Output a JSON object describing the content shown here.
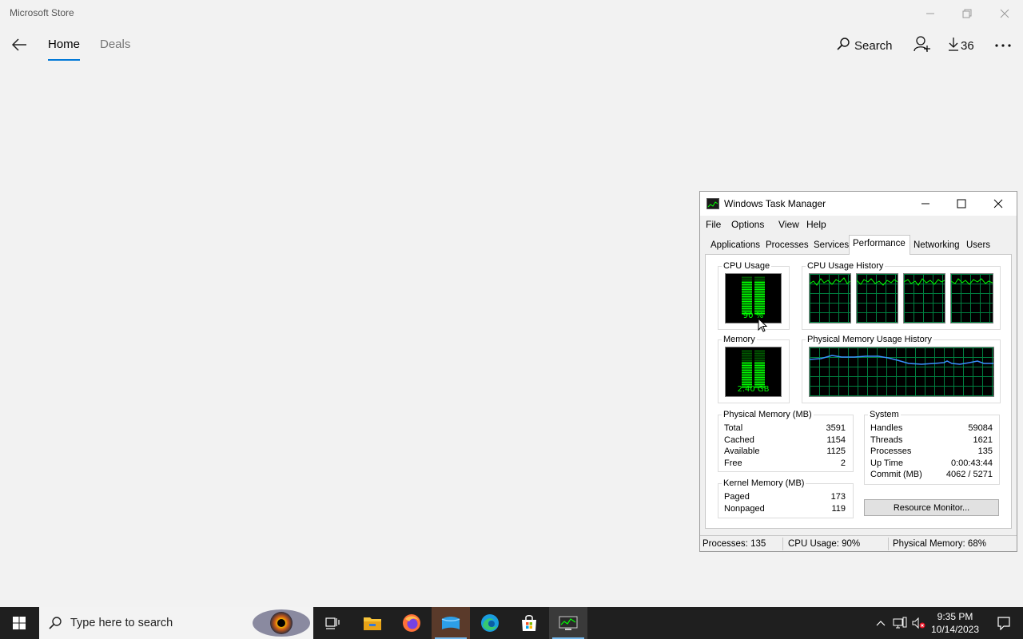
{
  "store": {
    "title": "Microsoft Store",
    "nav": {
      "home": "Home",
      "deals": "Deals"
    },
    "actions": {
      "search": "Search",
      "downloads": "36"
    }
  },
  "task_manager": {
    "title": "Windows Task Manager",
    "menu": [
      "File",
      "Options",
      "View",
      "Help"
    ],
    "tabs": [
      "Applications",
      "Processes",
      "Services",
      "Performance",
      "Networking",
      "Users"
    ],
    "active_tab": "Performance",
    "cpu_usage": {
      "label": "CPU Usage",
      "value": "90 %",
      "percent": 90
    },
    "cpu_history": {
      "label": "CPU Usage History",
      "cores": 4
    },
    "memory": {
      "label": "Memory",
      "value": "2.40 GB",
      "percent": 68
    },
    "memory_history": {
      "label": "Physical Memory Usage History"
    },
    "physical_memory": {
      "label": "Physical Memory (MB)",
      "rows": [
        {
          "k": "Total",
          "v": "3591"
        },
        {
          "k": "Cached",
          "v": "1154"
        },
        {
          "k": "Available",
          "v": "1125"
        },
        {
          "k": "Free",
          "v": "2"
        }
      ]
    },
    "kernel_memory": {
      "label": "Kernel Memory (MB)",
      "rows": [
        {
          "k": "Paged",
          "v": "173"
        },
        {
          "k": "Nonpaged",
          "v": "119"
        }
      ]
    },
    "system": {
      "label": "System",
      "rows": [
        {
          "k": "Handles",
          "v": "59084"
        },
        {
          "k": "Threads",
          "v": "1621"
        },
        {
          "k": "Processes",
          "v": "135"
        },
        {
          "k": "Up Time",
          "v": "0:00:43:44"
        },
        {
          "k": "Commit (MB)",
          "v": "4062 / 5271"
        }
      ]
    },
    "resource_monitor_button": "Resource Monitor...",
    "status": {
      "processes": "Processes: 135",
      "cpu": "CPU Usage: 90%",
      "memory": "Physical Memory: 68%"
    }
  },
  "taskbar": {
    "search_placeholder": "Type here to search",
    "time": "9:35 PM",
    "date": "10/14/2023"
  },
  "colors": {
    "accent": "#0078d7",
    "graph_green": "#00ff00",
    "graph_grid": "#008040",
    "mem_line": "#3a8fff"
  }
}
